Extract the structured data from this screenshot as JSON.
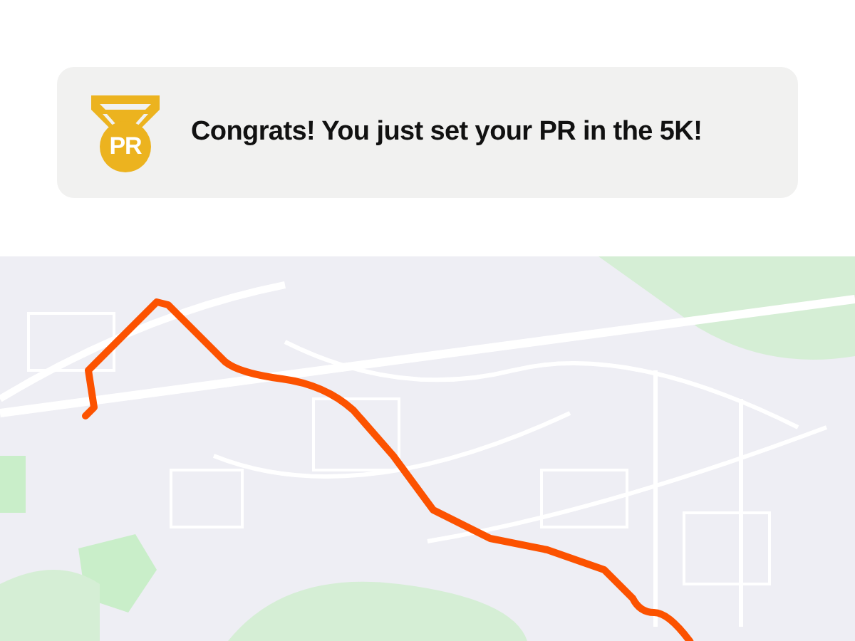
{
  "achievement": {
    "badge": "PR",
    "message": "Congrats! You just set your PR in the 5K!"
  }
}
